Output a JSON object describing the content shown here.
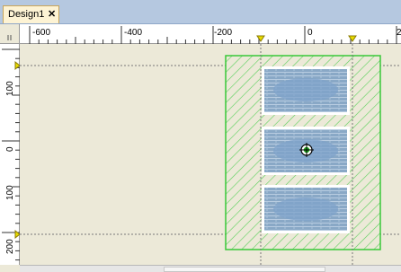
{
  "tab": {
    "label": "Design1",
    "close": "✕"
  },
  "hruler": {
    "labels": [
      "-600",
      "-400",
      "-200",
      "0",
      "2"
    ]
  },
  "vruler": {
    "labels": [
      "100",
      "0",
      "100",
      "200"
    ]
  },
  "canvas": {
    "container_icon": "crosshair-icon",
    "image_icon": "picture-placeholder-icon",
    "guide_color": "#777777",
    "container_color": "#38c838",
    "image_fill": "#89a8c6"
  }
}
